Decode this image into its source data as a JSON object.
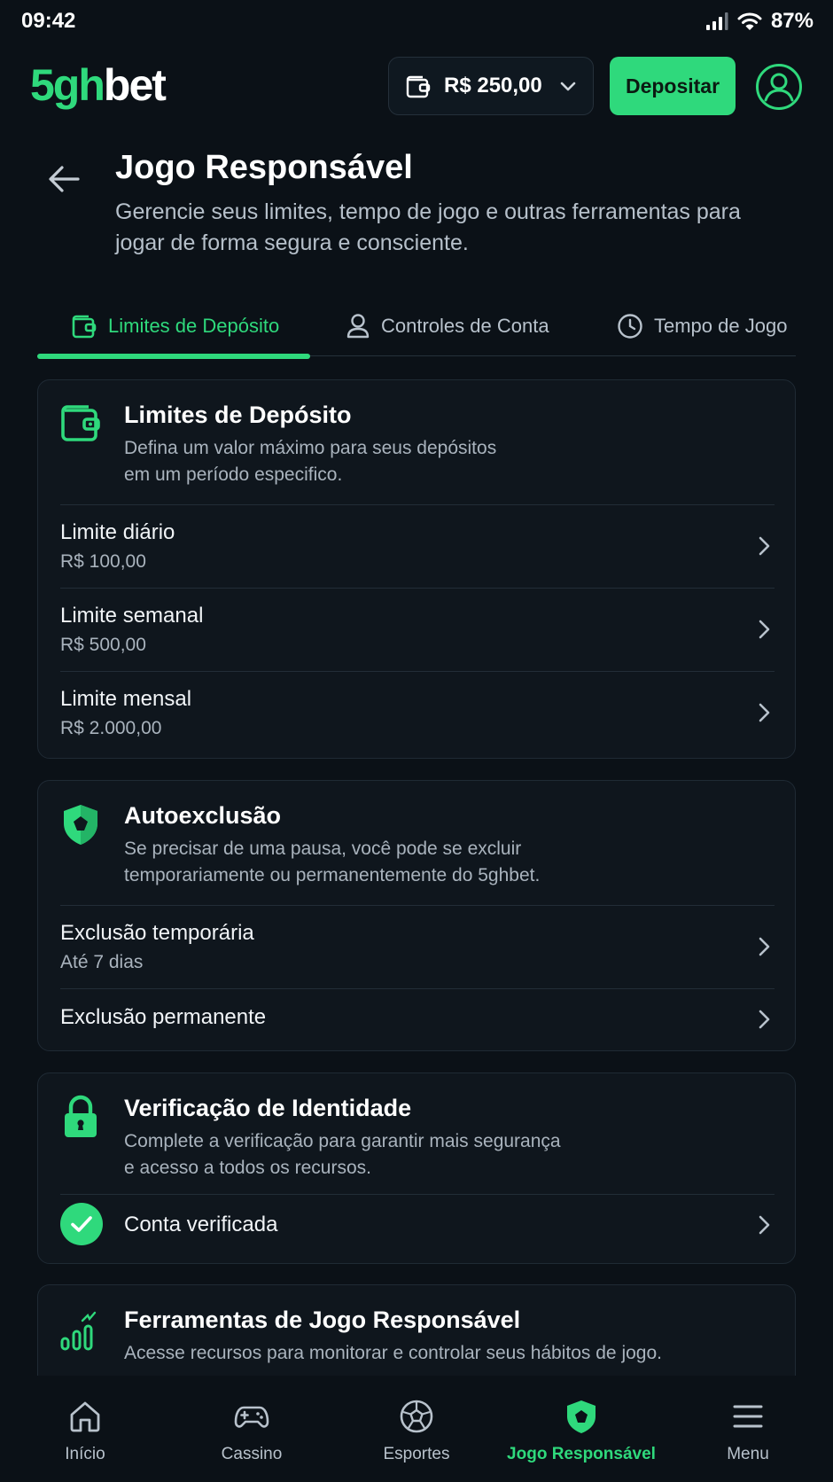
{
  "status_bar": {
    "time": "09:42",
    "battery": "87%",
    "icons": [
      "signal-icon",
      "wifi-icon"
    ]
  },
  "header": {
    "logo_prefix": "5gh",
    "logo_suffix": "bet",
    "balance": "R$ 250,00",
    "deposit_label": "Depositar",
    "icons": [
      "wallet-icon",
      "chevron-down-icon",
      "user-avatar-icon"
    ]
  },
  "page": {
    "title": "Jogo Responsável",
    "subtitle": "Gerencie seus limites, tempo de jogo e outras ferramentas para jogar de forma segura e consciente."
  },
  "tabs": [
    {
      "label": "Limites de Depósito",
      "icon": "wallet-icon",
      "active": true
    },
    {
      "label": "Controles de Conta",
      "icon": "user-icon",
      "active": false
    },
    {
      "label": "Tempo de Jogo",
      "icon": "clock-icon",
      "active": false
    }
  ],
  "cards": {
    "deposit": {
      "title": "Limites de Depósito",
      "desc_line1": "Defina um valor máximo para seus depósitos",
      "desc_line2": "em um período especifico.",
      "rows": [
        {
          "title": "Limite diário",
          "value": "R$ 100,00"
        },
        {
          "title": "Limite semanal",
          "value": "R$ 500,00"
        },
        {
          "title": "Limite mensal",
          "value": "R$ 2.000,00"
        }
      ]
    },
    "self_exclusion": {
      "title": "Autoexclusão",
      "desc_line1": "Se precisar de uma pausa, você pode se excluir",
      "desc_line2": "temporariamente ou permanentemente do 5ghbet.",
      "rows": [
        {
          "title": "Exclusão temporária",
          "value": "Até 7 dias"
        },
        {
          "title": "Exclusão permanente"
        }
      ]
    },
    "identity": {
      "title": "Verificação de Identidade",
      "desc_line1": "Complete a verificação para garantir mais segurança",
      "desc_line2": "e acesso a todos os recursos.",
      "status": "Conta verificada"
    },
    "tools": {
      "title": "Ferramentas de Jogo Responsável",
      "desc": "Acesse recursos para monitorar e controlar seus hábitos de jogo."
    }
  },
  "bottom_nav": [
    {
      "label": "Início",
      "icon": "home-icon",
      "active": false
    },
    {
      "label": "Cassino",
      "icon": "gamepad-icon",
      "active": false
    },
    {
      "label": "Esportes",
      "icon": "soccer-ball-icon",
      "active": false
    },
    {
      "label": "Jogo Responsável",
      "icon": "shield-icon",
      "active": true
    },
    {
      "label": "Menu",
      "icon": "menu-icon",
      "active": false
    }
  ],
  "colors": {
    "accent": "#2fd97c",
    "background": "#0b1117",
    "card": "#0f161d",
    "text_muted": "#a9b3bd"
  }
}
